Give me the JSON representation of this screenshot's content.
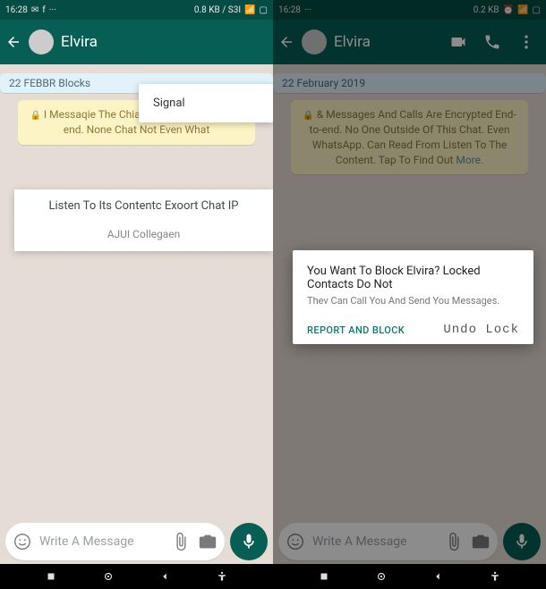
{
  "left": {
    "status": {
      "time": "16:28",
      "net": "0.8 KB / S3I"
    },
    "contact": "Elvira",
    "date_chip": "22 FEBBR Blocks",
    "encryption": "I Messaqie The Chia Empties Chat End-to-end. None Chat Not Even What",
    "popup_signal": "Signal",
    "popup_listen": "Listen To Its Contentc Exoort Chat IP",
    "popup_collegaen": "AJUI Collegaen",
    "input_placeholder": "Write A Message"
  },
  "right": {
    "status": {
      "time": "16:28",
      "net": "0.2 KB"
    },
    "contact": "Elvira",
    "date_chip": "22 February 2019",
    "encryption": "& Messages And Calls Are Encrypted End-to-end. No One Outside Of This Chat. Even WhatsApp. Can Read From Listen To The Content. Tap To Find Out",
    "more": "More.",
    "dialog_title": "You Want To Block Elvira? Locked Contacts Do Not",
    "dialog_sub": "Thev Can Call You And Send You Messages.",
    "action_report": "REPORT AND BLOCK",
    "action_undo": "Undo Lock",
    "input_placeholder": "Write A Message"
  }
}
